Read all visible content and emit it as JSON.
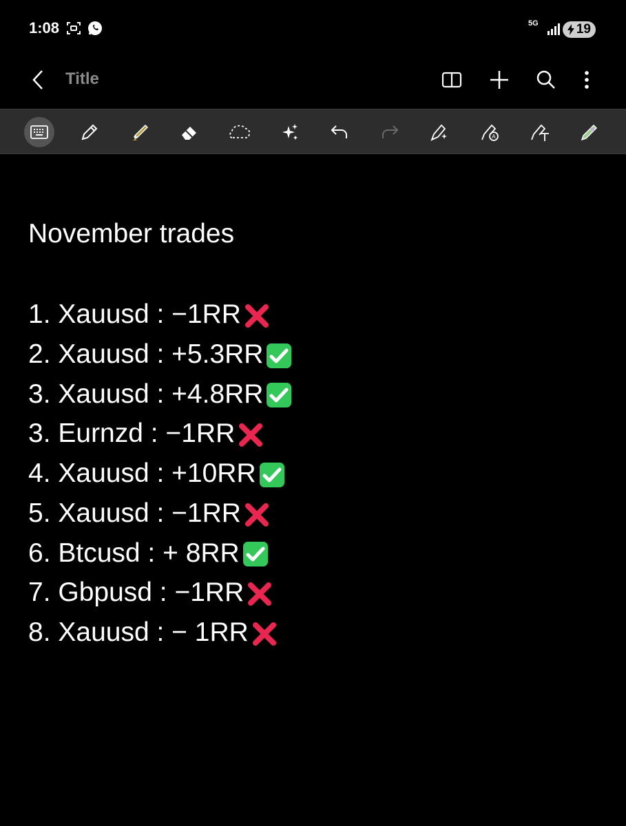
{
  "status_bar": {
    "time": "1:08",
    "network": "5G",
    "battery": "19",
    "icons": [
      "screenshot-icon",
      "whatsapp-icon",
      "signal-icon",
      "battery-icon"
    ]
  },
  "app_bar": {
    "title_placeholder": "Title",
    "icons": [
      "back-icon",
      "book-icon",
      "add-icon",
      "search-icon",
      "more-icon"
    ]
  },
  "toolbar": {
    "tools": [
      "keyboard",
      "pen",
      "highlighter",
      "eraser",
      "lasso-selection",
      "ai-assist",
      "undo",
      "redo",
      "shape-recognition",
      "handwriting-to-text",
      "text-recognition",
      "pen-settings"
    ],
    "active_tool": "keyboard"
  },
  "note": {
    "heading": "November trades",
    "trades": [
      {
        "text": "1. Xauusd : −1RR",
        "result": "loss"
      },
      {
        "text": "2. Xauusd : +5.3RR",
        "result": "win"
      },
      {
        "text": "3. Xauusd : +4.8RR",
        "result": "win"
      },
      {
        "text": "3. Eurnzd : −1RR",
        "result": "loss"
      },
      {
        "text": "4. Xauusd : +10RR",
        "result": "win"
      },
      {
        "text": "5. Xauusd : −1RR",
        "result": "loss"
      },
      {
        "text": "6. Btcusd : + 8RR",
        "result": "win"
      },
      {
        "text": "7. Gbpusd : −1RR",
        "result": "loss"
      },
      {
        "text": "8. Xauusd : − 1RR",
        "result": "loss"
      }
    ]
  },
  "colors": {
    "background": "#000000",
    "toolbar": "#2d2d2d",
    "title_placeholder": "#8a8a8a",
    "win_check_bg": "#34c759",
    "loss_cross": "#e8264f"
  }
}
